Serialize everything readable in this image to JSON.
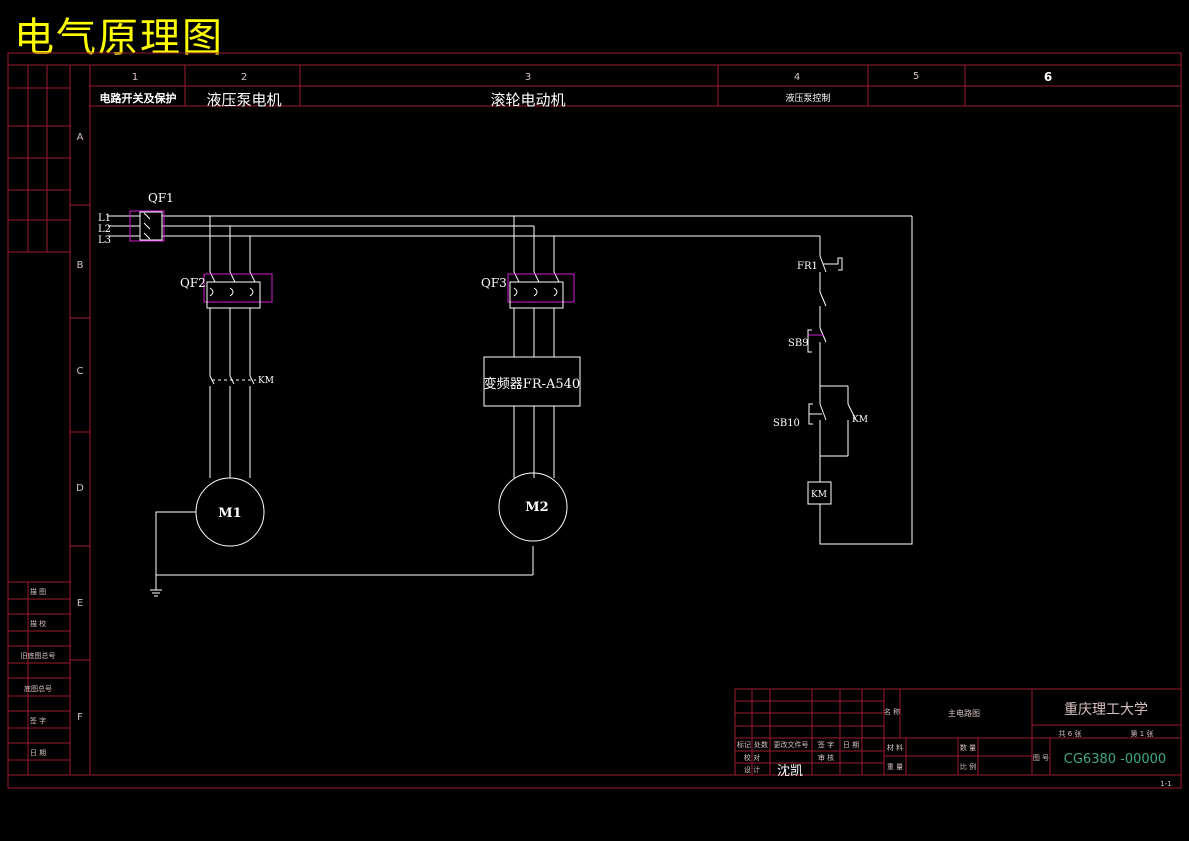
{
  "title": "电气原理图",
  "columns": [
    {
      "num": "1",
      "label": "电路开关及保护"
    },
    {
      "num": "2",
      "label": "液压泵电机"
    },
    {
      "num": "3",
      "label": "滚轮电动机"
    },
    {
      "num": "4",
      "label": "液压泵控制"
    },
    {
      "num": "5",
      "label": ""
    },
    {
      "num": "6",
      "label": ""
    }
  ],
  "rows": [
    "A",
    "B",
    "C",
    "D",
    "E",
    "F"
  ],
  "components": {
    "qf1": "QF1",
    "qf2": "QF2",
    "qf3": "QF3",
    "km_main": "KM",
    "inverter": "变频器FR-A540",
    "m1": "M1",
    "m2": "M2",
    "fr1": "FR1",
    "sb9": "SB9",
    "sb10": "SB10",
    "km_aux": "KM",
    "km_coil": "KM",
    "l1": "L1",
    "l2": "L2",
    "l3": "L3"
  },
  "left_table": [
    "描 图",
    "描 校",
    "旧底图总号",
    "底图总号",
    "签 字",
    "日 期"
  ],
  "title_block": {
    "drawing_name": "主电路图",
    "school": "重庆理工大学",
    "sheets_total": "共 6 张",
    "sheet_no": "第 1 张",
    "drawing_code": "CG6380 -00000",
    "designer_name": "沈凯",
    "h_mark": "标记",
    "h_qty": "处数",
    "h_doc": "更改文件号",
    "h_sign": "签 字",
    "h_date": "日 期",
    "h_check": "校 对",
    "h_review": "审 核",
    "h_design": "设 计",
    "h_material": "材 料",
    "h_weight": "重 量",
    "h_amount": "数 量",
    "h_scale": "比 例",
    "h_name": "名 称",
    "h_code": "图 号",
    "corner": "1-1"
  }
}
